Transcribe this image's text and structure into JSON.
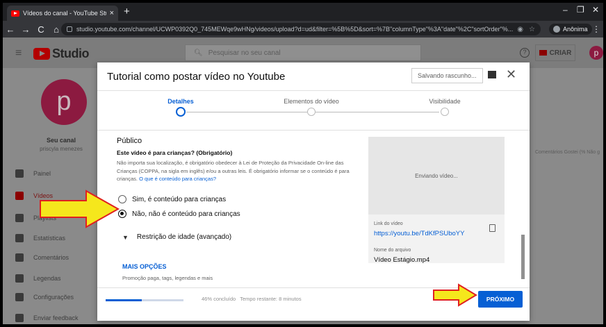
{
  "browser": {
    "tab_title": "Vídeos do canal - YouTube Studi",
    "url": "studio.youtube.com/channel/UCWP0392Q0_745MEWqe9wHNg/videos/upload?d=ud&filter=%5B%5D&sort=%7B\"columnType\"%3A\"date\"%2C\"sortOrder\"%...",
    "profile_label": "Anônima"
  },
  "studio": {
    "logo_text": "Studio",
    "search_placeholder": "Pesquisar no seu canal",
    "create_label": "CRIAR",
    "avatar_letter": "p",
    "channel_pic_letter": "p",
    "channel_name": "Seu canal",
    "channel_user": "priscyla menezes",
    "nav": [
      "Painel",
      "Vídeos",
      "Playlists",
      "Estatísticas",
      "Comentários",
      "Legendas",
      "Configurações",
      "Enviar feedback"
    ],
    "bg_right_text": "Comentários   Gostei (% Não g"
  },
  "modal": {
    "title": "Tutorial como postar vídeo no Youtube",
    "saving_label": "Salvando rascunho...",
    "steps": [
      "Detalhes",
      "Elementos do vídeo",
      "Visibilidade"
    ],
    "publico_heading": "Público",
    "question": "Este vídeo é para crianças? (Obrigatório)",
    "description": "Não importa sua localização, é obrigatório obedecer à Lei de Proteção da Privacidade On-line das Crianças (COPPA, na sigla em inglês) e/ou a outras leis. É obrigatório informar se o conteúdo é para crianças.",
    "description_link": "O que é conteúdo para crianças?",
    "option_yes": "Sim, é conteúdo para crianças",
    "option_no": "Não, não é conteúdo para crianças",
    "age_restriction": "Restrição de idade (avançado)",
    "more_options": "MAIS OPÇÕES",
    "more_options_sub": "Promoção paga, tags, legendas e mais",
    "preview_status": "Enviando vídeo...",
    "link_label": "Link do vídeo",
    "link_value": "https://youtu.be/TdKfPSUboYY",
    "file_label": "Nome do arquivo",
    "file_value": "Vídeo Estágio.mp4",
    "progress_percent": 46,
    "progress_text": "46% concluído",
    "time_remaining": "Tempo restante: 8 minutos",
    "next_label": "PRÓXIMO"
  },
  "colors": {
    "accent": "#065fd4",
    "arrow": "#f5e71c",
    "arrow_outline": "#e02020",
    "brand": "#ff0000"
  }
}
